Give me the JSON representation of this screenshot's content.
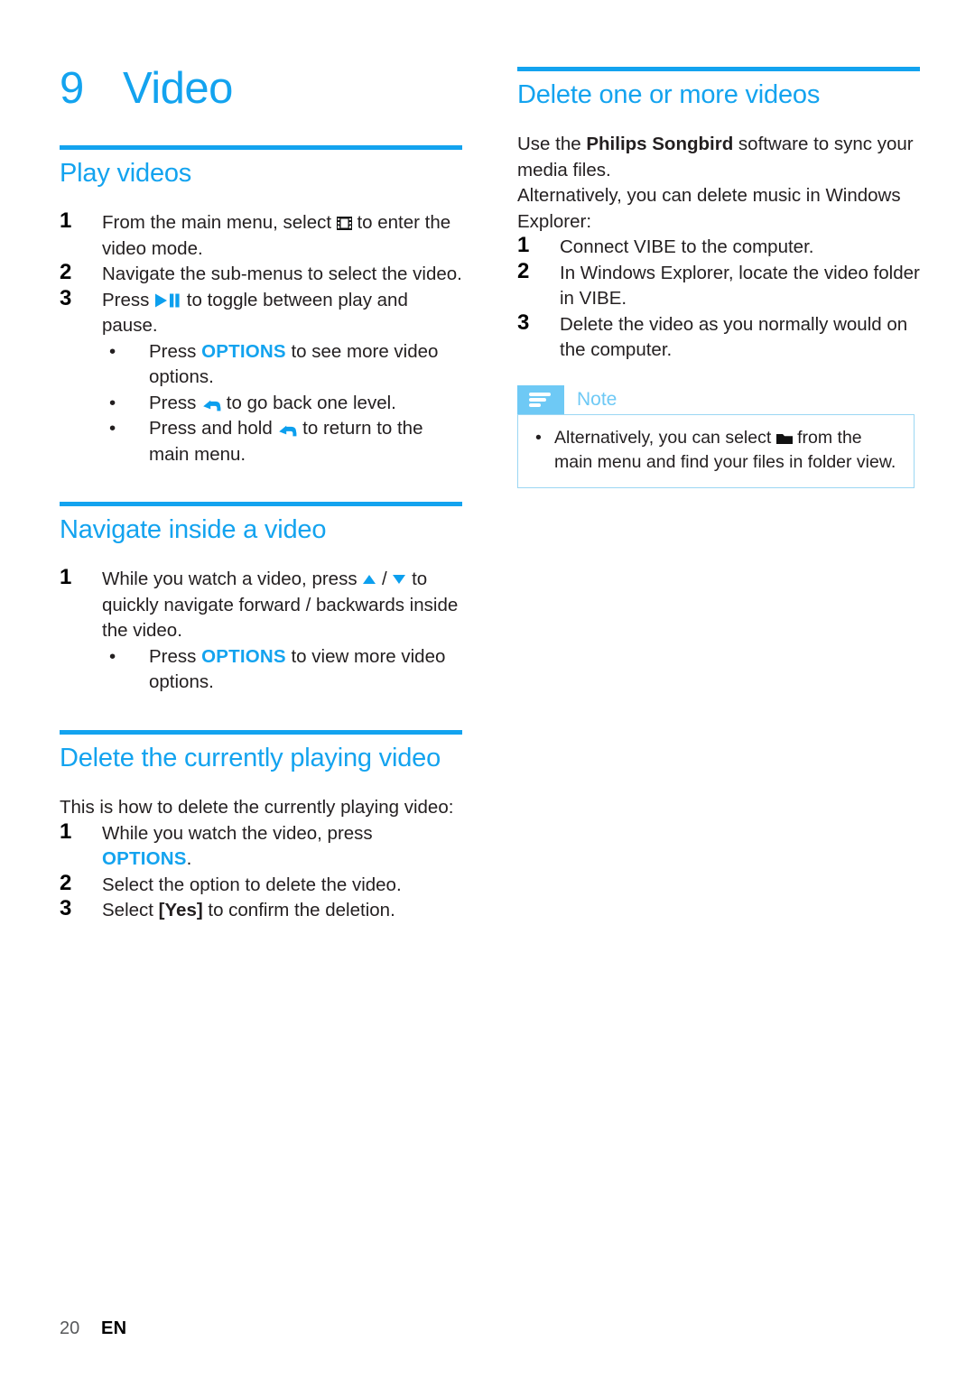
{
  "colors": {
    "accent_blue": "#13A3EF",
    "note_tab_blue": "#6EC9F5",
    "note_border_blue": "#9BD7F3",
    "body_text": "#231F20"
  },
  "chapter": {
    "number": "9",
    "title": "Video"
  },
  "left_column": {
    "sections": [
      {
        "heading": "Play videos",
        "steps": [
          {
            "num": "1",
            "parts": [
              {
                "t": "text",
                "v": "From the main menu, select "
              },
              {
                "t": "icon",
                "v": "video-icon"
              },
              {
                "t": "text",
                "v": " to enter the video mode."
              }
            ]
          },
          {
            "num": "2",
            "parts": [
              {
                "t": "text",
                "v": "Navigate the sub-menus to select the video."
              }
            ]
          },
          {
            "num": "3",
            "parts": [
              {
                "t": "text",
                "v": "Press "
              },
              {
                "t": "icon",
                "v": "play-pause-icon"
              },
              {
                "t": "text",
                "v": " to toggle between play and pause."
              }
            ],
            "bullets": [
              [
                {
                  "t": "text",
                  "v": "Press "
                },
                {
                  "t": "kw",
                  "v": "OPTIONS"
                },
                {
                  "t": "text",
                  "v": " to see more video options."
                }
              ],
              [
                {
                  "t": "text",
                  "v": "Press "
                },
                {
                  "t": "icon",
                  "v": "back-icon"
                },
                {
                  "t": "text",
                  "v": " to go back one level."
                }
              ],
              [
                {
                  "t": "text",
                  "v": "Press and hold "
                },
                {
                  "t": "icon",
                  "v": "back-icon"
                },
                {
                  "t": "text",
                  "v": " to return to the main menu."
                }
              ]
            ]
          }
        ]
      },
      {
        "heading": "Navigate inside a video",
        "steps": [
          {
            "num": "1",
            "parts": [
              {
                "t": "text",
                "v": "While you watch a video, press "
              },
              {
                "t": "icon",
                "v": "triangle-up-icon"
              },
              {
                "t": "text",
                "v": " / "
              },
              {
                "t": "icon",
                "v": "triangle-down-icon"
              },
              {
                "t": "text",
                "v": " to quickly navigate forward / backwards inside the video."
              }
            ],
            "bullets": [
              [
                {
                  "t": "text",
                  "v": "Press "
                },
                {
                  "t": "kw",
                  "v": "OPTIONS"
                },
                {
                  "t": "text",
                  "v": " to view more video options."
                }
              ]
            ]
          }
        ]
      },
      {
        "heading": "Delete the currently playing video",
        "intro": "This is how to delete the currently playing video:",
        "steps": [
          {
            "num": "1",
            "parts": [
              {
                "t": "text",
                "v": "While you watch the video, press "
              },
              {
                "t": "kw",
                "v": "OPTIONS"
              },
              {
                "t": "text",
                "v": "."
              }
            ]
          },
          {
            "num": "2",
            "parts": [
              {
                "t": "text",
                "v": "Select the option to delete the video."
              }
            ]
          },
          {
            "num": "3",
            "parts": [
              {
                "t": "text",
                "v": "Select "
              },
              {
                "t": "b",
                "v": "[Yes]"
              },
              {
                "t": "text",
                "v": " to confirm the deletion."
              }
            ]
          }
        ]
      }
    ]
  },
  "right_column": {
    "sections": [
      {
        "heading": "Delete one or more videos",
        "intro_parts": [
          {
            "t": "text",
            "v": "Use the "
          },
          {
            "t": "b",
            "v": "Philips Songbird"
          },
          {
            "t": "text",
            "v": " software to sync your media files."
          },
          {
            "t": "br",
            "v": ""
          },
          {
            "t": "text",
            "v": "Alternatively, you can delete music in Windows Explorer:"
          }
        ],
        "steps": [
          {
            "num": "1",
            "parts": [
              {
                "t": "text",
                "v": "Connect VIBE to the computer."
              }
            ]
          },
          {
            "num": "2",
            "parts": [
              {
                "t": "text",
                "v": "In Windows Explorer, locate the video folder in VIBE."
              }
            ]
          },
          {
            "num": "3",
            "parts": [
              {
                "t": "text",
                "v": "Delete the video as you normally would on the computer."
              }
            ]
          }
        ]
      }
    ],
    "note": {
      "label": "Note",
      "icon": "note-lines-icon",
      "bullets": [
        [
          {
            "t": "text",
            "v": "Alternatively, you can select "
          },
          {
            "t": "icon",
            "v": "folder-icon"
          },
          {
            "t": "text",
            "v": " from the main menu and find your files in folder view."
          }
        ]
      ]
    }
  },
  "footer": {
    "page_number": "20",
    "language": "EN"
  },
  "bullet_glyph": "•"
}
